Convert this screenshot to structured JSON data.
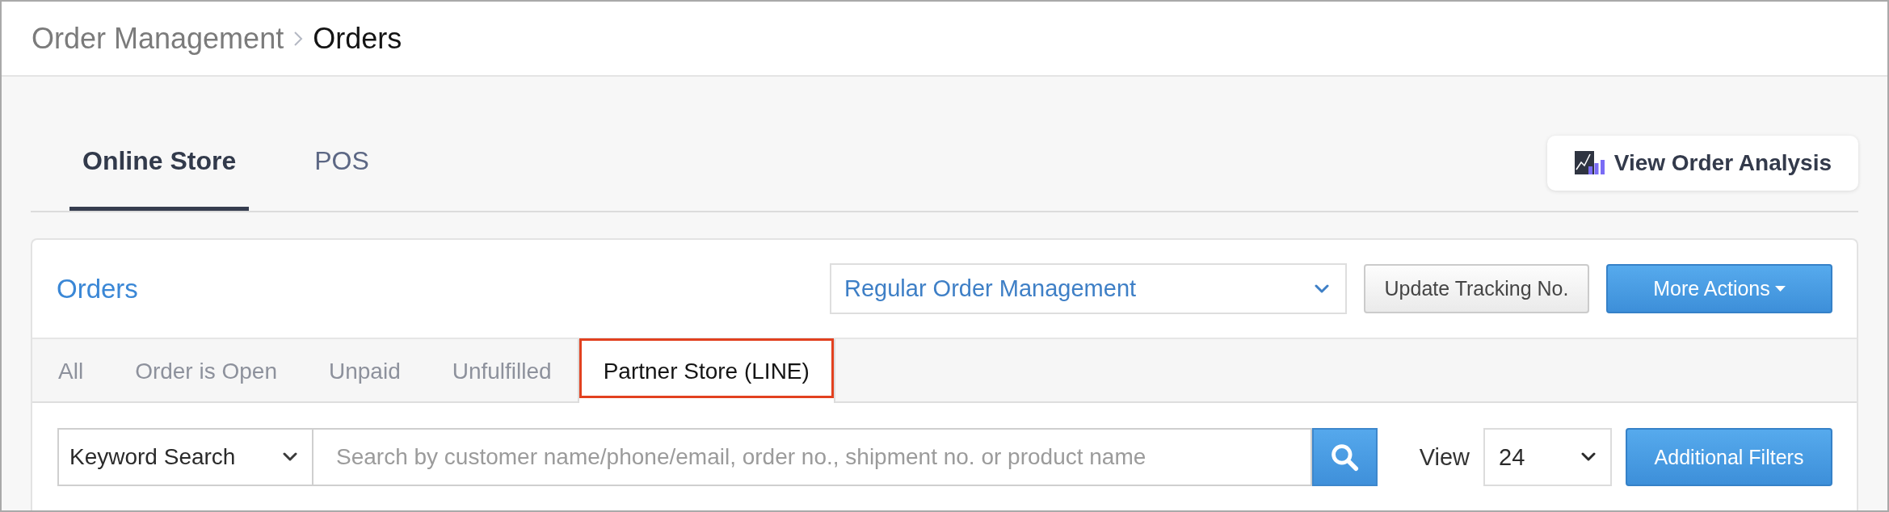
{
  "breadcrumb": [
    {
      "label": "Order Management",
      "current": false
    },
    {
      "label": "Orders",
      "current": true
    }
  ],
  "channel_tabs": [
    {
      "label": "Online Store",
      "selected": true
    },
    {
      "label": "POS",
      "selected": false
    }
  ],
  "analysis_button": {
    "label": "View Order Analysis"
  },
  "orders_card": {
    "title": "Orders",
    "order_type": {
      "value": "Regular Order Management"
    },
    "actions": [
      {
        "label": "Update Tracking No.",
        "kind": "secondary"
      },
      {
        "label": "More Actions",
        "kind": "menu"
      }
    ],
    "status_tabs": [
      {
        "label": "All",
        "selected": false,
        "highlighted": false
      },
      {
        "label": "Order is Open",
        "selected": false,
        "highlighted": false
      },
      {
        "label": "Unpaid",
        "selected": false,
        "highlighted": false
      },
      {
        "label": "Unfulfilled",
        "selected": false,
        "highlighted": false
      },
      {
        "label": "Partner Store (LINE)",
        "selected": true,
        "highlighted": true
      }
    ],
    "search": {
      "field_type": {
        "value": "Keyword Search"
      },
      "placeholder": "Search by customer name/phone/email, order no., shipment no. or product name",
      "view_label": "View",
      "page_size": {
        "value": "24"
      },
      "filter_button": {
        "label": "Additional Filters"
      }
    }
  }
}
